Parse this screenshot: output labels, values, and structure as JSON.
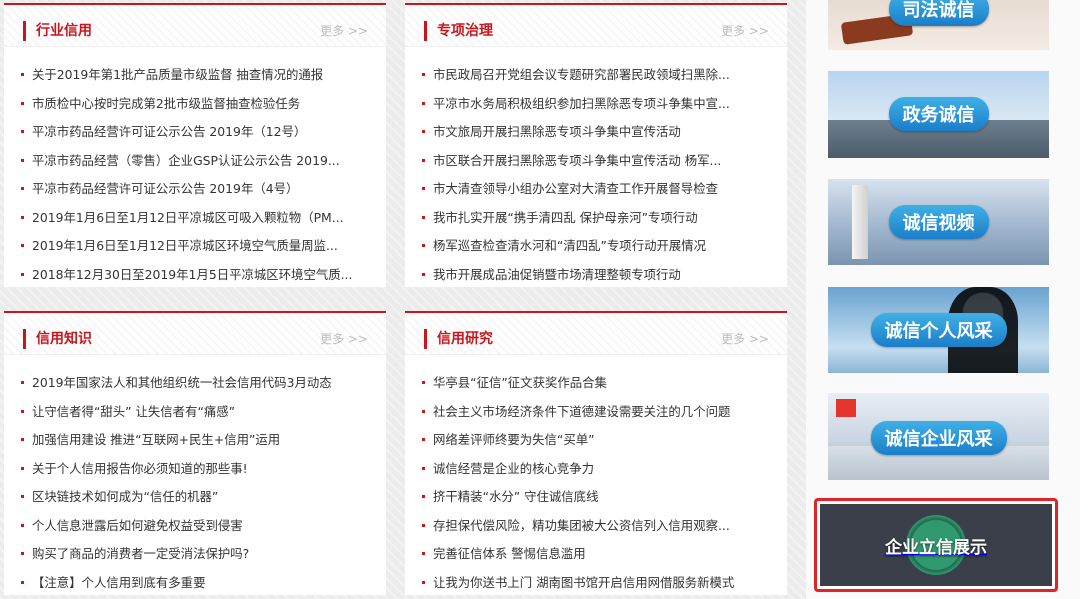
{
  "panels": [
    {
      "title": "行业信用",
      "more": "更多 >>",
      "items": [
        "关于2019年第1批产品质量市级监督 抽查情况的通报",
        "市质检中心按时完成第2批市级监督抽查检验任务",
        "平凉市药品经营许可证公示公告 2019年（12号）",
        "平凉市药品经营（零售）企业GSP认证公示公告 2019...",
        "平凉市药品经营许可证公示公告 2019年（4号）",
        "2019年1月6日至1月12日平凉城区可吸入颗粒物（PM...",
        "2019年1月6日至1月12日平凉城区环境空气质量周监...",
        "2018年12月30日至2019年1月5日平凉城区环境空气质..."
      ]
    },
    {
      "title": "专项治理",
      "more": "更多 >>",
      "items": [
        "市民政局召开党组会议专题研究部署民政领域扫黑除...",
        "平凉市水务局积极组织参加扫黑除恶专项斗争集中宣...",
        "市文旅局开展扫黑除恶专项斗争集中宣传活动",
        "市区联合开展扫黑除恶专项斗争集中宣传活动 杨军...",
        "市大清查领导小组办公室对大清查工作开展督导检查",
        "我市扎实开展“携手清四乱 保护母亲河”专项行动",
        "杨军巡查检查清水河和“清四乱”专项行动开展情况",
        "我市开展成品油促销暨市场清理整顿专项行动"
      ]
    },
    {
      "title": "信用知识",
      "more": "更多 >>",
      "items": [
        "2019年国家法人和其他组织统一社会信用代码3月动态",
        "让守信者得“甜头” 让失信者有“痛感”",
        "加强信用建设 推进“互联网+民生+信用”运用",
        "关于个人信用报告你必须知道的那些事!",
        "区块链技术如何成为“信任的机器”",
        "个人信息泄露后如何避免权益受到侵害",
        "购买了商品的消费者一定受消法保护吗?",
        "【注意】个人信用到底有多重要"
      ]
    },
    {
      "title": "信用研究",
      "more": "更多 >>",
      "items": [
        "华亭县“征信”征文获奖作品合集",
        "社会主义市场经济条件下道德建设需要关注的几个问题",
        "网络差评师终要为失信“买单”",
        "诚信经营是企业的核心竞争力",
        "挤干精装“水分” 守住诚信底线",
        "存担保代偿风险，精功集团被大公资信列入信用观察...",
        "完善征信体系 警惕信息滥用",
        "让我为你送书上门 湖南图书馆开启信用网借服务新模式"
      ]
    }
  ],
  "banners": [
    {
      "label": "司法诚信"
    },
    {
      "label": "政务诚信"
    },
    {
      "label": "诚信视频"
    },
    {
      "label": "诚信个人风采"
    },
    {
      "label": "诚信企业风采"
    },
    {
      "label": "企业立信展示"
    }
  ],
  "colors": {
    "accent": "#c8161e",
    "highlight_border": "#e0242a",
    "pill": "#1b7ec8"
  }
}
